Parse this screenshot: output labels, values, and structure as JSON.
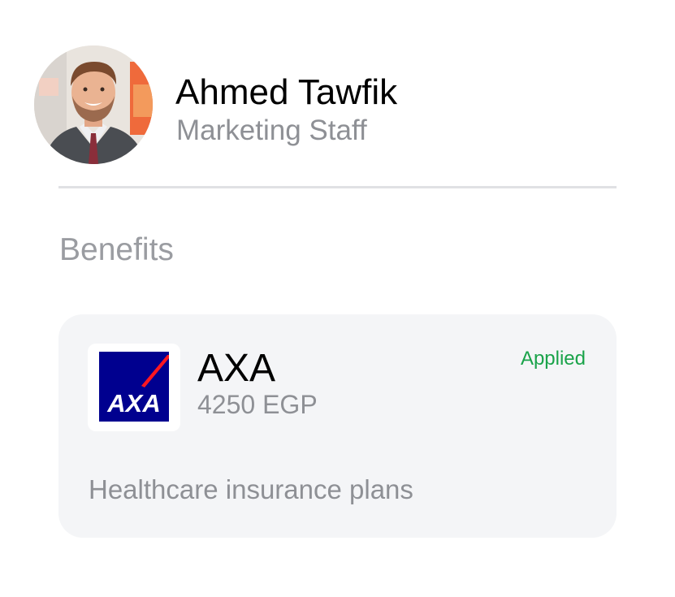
{
  "profile": {
    "name": "Ahmed Tawfik",
    "role": "Marketing Staff"
  },
  "benefits": {
    "section_title": "Benefits",
    "card": {
      "provider": "AXA",
      "amount": "4250 EGP",
      "status": "Applied",
      "description": "Healthcare insurance plans",
      "logo_text": "AXA",
      "logo_icon": "axa-logo-icon",
      "colors": {
        "logo_blue": "#00008f",
        "logo_red": "#ff1721",
        "status_green": "#1aa34a"
      }
    }
  }
}
